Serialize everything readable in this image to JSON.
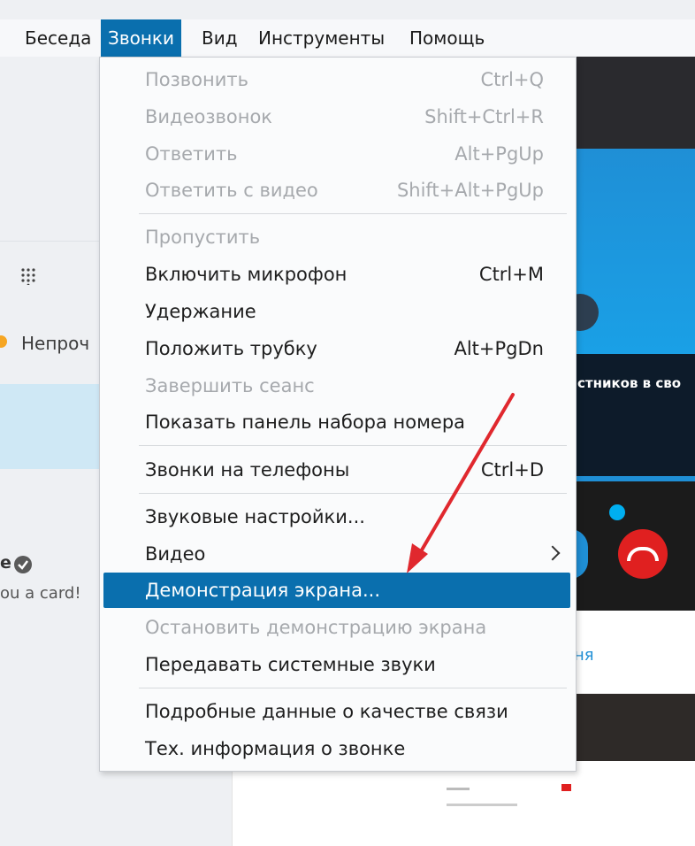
{
  "menubar": {
    "items": [
      {
        "label": "Беседа",
        "active": false
      },
      {
        "label": "Звонки",
        "active": true
      },
      {
        "label": "Вид",
        "active": false
      },
      {
        "label": "Инструменты",
        "active": false
      },
      {
        "label": "Помощь",
        "active": false
      }
    ]
  },
  "sidebar": {
    "unread_text": "Непроч",
    "contact_partial": "e",
    "message_partial": "ou a card!",
    "status_color": "#f6a623"
  },
  "right_panel": {
    "caption_partial": "стников в сво",
    "link_partial": "ня"
  },
  "calls_menu": {
    "items": [
      {
        "label": "Позвонить",
        "shortcut": "Ctrl+Q",
        "disabled": true
      },
      {
        "label": "Видеозвонок",
        "shortcut": "Shift+Ctrl+R",
        "disabled": true
      },
      {
        "label": "Ответить",
        "shortcut": "Alt+PgUp",
        "disabled": true
      },
      {
        "label": "Ответить с видео",
        "shortcut": "Shift+Alt+PgUp",
        "disabled": true
      },
      {
        "label": "Пропустить",
        "shortcut": "",
        "disabled": true
      },
      {
        "label": "Включить микрофон",
        "shortcut": "Ctrl+M",
        "disabled": false
      },
      {
        "label": "Удержание",
        "shortcut": "",
        "disabled": false
      },
      {
        "label": "Положить трубку",
        "shortcut": "Alt+PgDn",
        "disabled": false
      },
      {
        "label": "Завершить сеанс",
        "shortcut": "",
        "disabled": true
      },
      {
        "label": "Показать панель набора номера",
        "shortcut": "",
        "disabled": false
      },
      {
        "label": "Звонки на телефоны",
        "shortcut": "Ctrl+D",
        "disabled": false
      },
      {
        "label": "Звуковые настройки...",
        "shortcut": "",
        "disabled": false
      },
      {
        "label": "Видео",
        "shortcut": "",
        "disabled": false,
        "submenu": true
      },
      {
        "label": "Демонстрация экрана...",
        "shortcut": "",
        "disabled": false,
        "highlighted": true
      },
      {
        "label": "Остановить демонстрацию экрана",
        "shortcut": "",
        "disabled": true
      },
      {
        "label": "Передавать системные звуки",
        "shortcut": "",
        "disabled": false
      },
      {
        "label": "Подробные данные о качестве связи",
        "shortcut": "",
        "disabled": false
      },
      {
        "label": "Тех. информация о звонке",
        "shortcut": "",
        "disabled": false
      }
    ]
  },
  "colors": {
    "accent": "#0a6fae",
    "annotation_arrow": "#e0282e"
  }
}
